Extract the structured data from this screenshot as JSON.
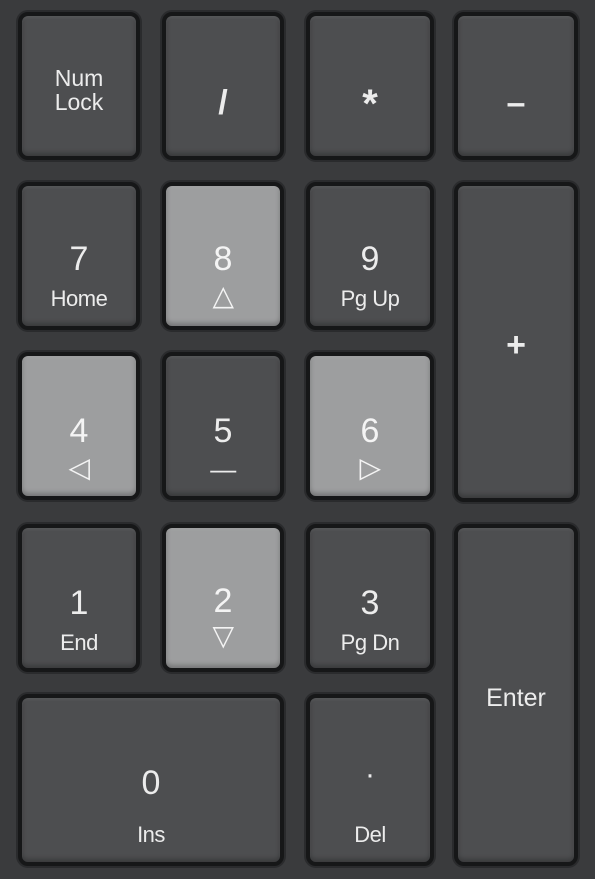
{
  "keys": {
    "numlock": {
      "line1": "Num",
      "line2": "Lock"
    },
    "divide": {
      "main": "/"
    },
    "multiply": {
      "main": "*"
    },
    "minus": {
      "main": "–"
    },
    "seven": {
      "main": "7",
      "sub": "Home"
    },
    "eight": {
      "main": "8",
      "sub": "△"
    },
    "nine": {
      "main": "9",
      "sub": "Pg Up"
    },
    "plus": {
      "main": "+"
    },
    "four": {
      "main": "4",
      "sub": "◁"
    },
    "five": {
      "main": "5",
      "sub": "—"
    },
    "six": {
      "main": "6",
      "sub": "▷"
    },
    "one": {
      "main": "1",
      "sub": "End"
    },
    "two": {
      "main": "2",
      "sub": "▽"
    },
    "three": {
      "main": "3",
      "sub": "Pg Dn"
    },
    "enter": {
      "main": "Enter"
    },
    "zero": {
      "main": "0",
      "sub": "Ins"
    },
    "dot": {
      "main": "·",
      "sub": "Del"
    }
  },
  "colors": {
    "key_dark": "#4d4e50",
    "key_light": "#9d9e9f",
    "frame": "#3a3b3d"
  }
}
